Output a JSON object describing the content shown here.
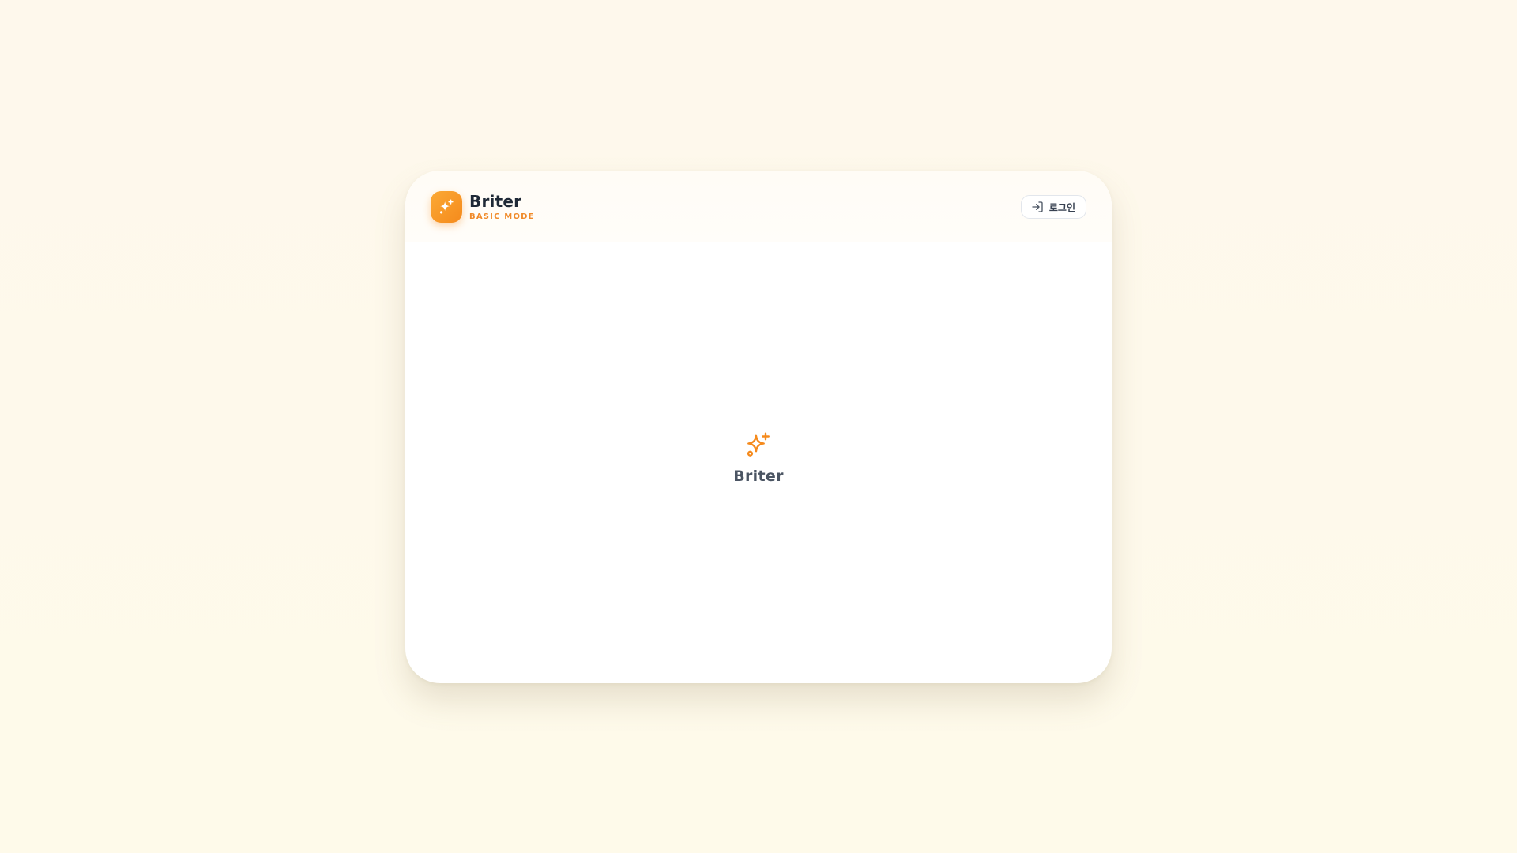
{
  "header": {
    "brand_name": "Briter",
    "brand_mode": "BASIC MODE",
    "brand_icon": "sparkles-icon",
    "login_label": "로그인",
    "login_icon": "login-icon"
  },
  "main": {
    "placeholder_icon": "sparkles-icon",
    "placeholder_label": "Briter"
  },
  "colors": {
    "accent": "#f58a1c",
    "accent_light": "#fba935",
    "background": "#fef8ec",
    "card": "#ffffff",
    "title_text": "#1f2937",
    "muted_text": "#4b5563"
  }
}
